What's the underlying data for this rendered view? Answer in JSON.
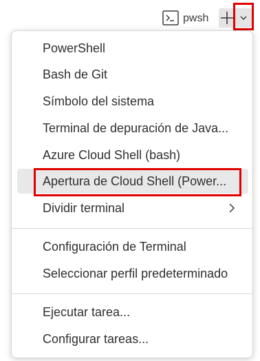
{
  "toolbar": {
    "terminal_name": "pwsh",
    "terminal_icon": "terminal-powershell-icon",
    "add_icon": "plus-icon",
    "dropdown_icon": "chevron-down-icon"
  },
  "menu": {
    "items": [
      {
        "label": "PowerShell"
      },
      {
        "label": "Bash de Git"
      },
      {
        "label": "Símbolo del sistema"
      },
      {
        "label": "Terminal de depuración de Java..."
      },
      {
        "label": "Azure Cloud Shell (bash)"
      },
      {
        "label": "Apertura de Cloud Shell (Power..."
      },
      {
        "label": "Dividir terminal"
      },
      {
        "label": "Configuración de Terminal"
      },
      {
        "label": "Seleccionar perfil predeterminado"
      },
      {
        "label": "Ejecutar tarea..."
      },
      {
        "label": "Configurar tareas..."
      }
    ],
    "submenu_icon": "chevron-right-icon"
  },
  "highlight_color": "#e00000"
}
